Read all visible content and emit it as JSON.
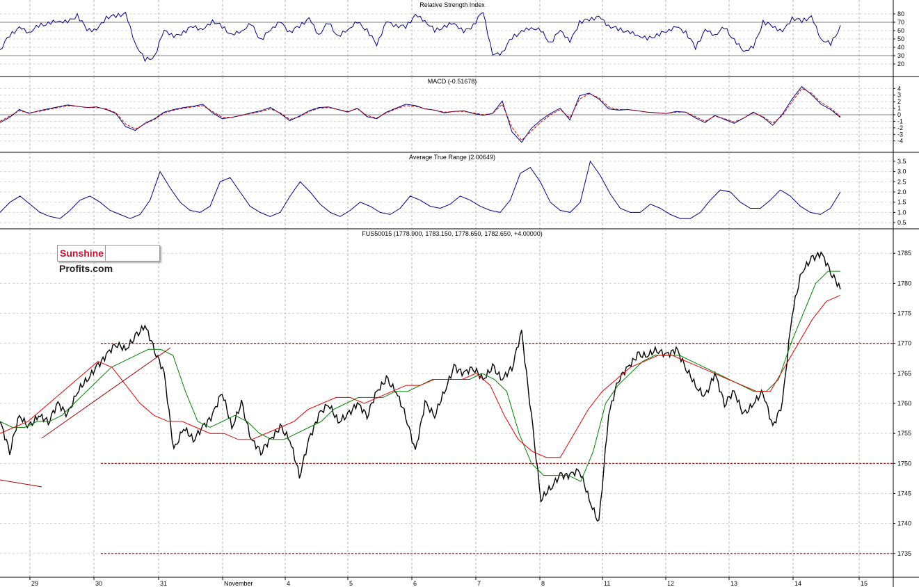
{
  "logo": {
    "part1": "Sunshine",
    "part2": "Profits.com"
  },
  "colors": {
    "price": "#000000",
    "ma_short": "#008000",
    "ma_long": "#e00000",
    "indicator": "#000080",
    "macd_signal": "#c00000",
    "support_line": "#a00000"
  },
  "chart_data": [
    {
      "type": "line",
      "title": "Relative Strength Index",
      "yticks": [
        "80",
        "70",
        "60",
        "50",
        "40",
        "30",
        "20"
      ],
      "ylim": [
        10,
        90
      ],
      "reference_lines": [
        70,
        30
      ],
      "series": [
        {
          "values": [
            37,
            55,
            63,
            58,
            66,
            68,
            72,
            70,
            78,
            62,
            60,
            76,
            78,
            80,
            45,
            25,
            28,
            62,
            52,
            58,
            66,
            60,
            72,
            65,
            54,
            60,
            68,
            48,
            62,
            70,
            58,
            66,
            74,
            55,
            70,
            52,
            62,
            70,
            60,
            44,
            70,
            66,
            65,
            78,
            72,
            60,
            64,
            70,
            58,
            66,
            84,
            30,
            34,
            52,
            58,
            64,
            60,
            44,
            62,
            46,
            70,
            74,
            76,
            66,
            62,
            58,
            55,
            50,
            54,
            60,
            64,
            58,
            40,
            60,
            55,
            64,
            48,
            36,
            40,
            70,
            66,
            58,
            75,
            72,
            76,
            50,
            44,
            64
          ]
        }
      ]
    },
    {
      "type": "line",
      "title": "MACD (-0.51678)",
      "yticks": [
        "4",
        "3",
        "2",
        "1",
        "0",
        "-1",
        "-2",
        "-3",
        "-4"
      ],
      "ylim": [
        -5.2,
        5.2
      ],
      "reference_lines": [
        0
      ],
      "series": [
        {
          "values": [
            -1.2,
            -0.4,
            0.8,
            0.2,
            0.6,
            0.9,
            1.2,
            1.5,
            1.3,
            1.1,
            1.2,
            0.8,
            0.2,
            -1.8,
            -2.4,
            -1.3,
            -0.6,
            0.4,
            0.8,
            1.1,
            1.3,
            1.6,
            0.3,
            -0.6,
            -0.4,
            -0.1,
            0.3,
            0.6,
            1.1,
            0.2,
            -0.9,
            -0.2,
            0.6,
            1.1,
            1.2,
            0.8,
            0.4,
            1.0,
            -0.3,
            -0.6,
            0.4,
            1.0,
            1.6,
            1.4,
            0.9,
            0.7,
            0.3,
            0.5,
            0.6,
            0.2,
            -0.1,
            0.2,
            2.1,
            -2.6,
            -4.2,
            -2.1,
            -0.8,
            0.2,
            1.0,
            -0.8,
            2.9,
            3.3,
            2.4,
            0.9,
            0.7,
            0.8,
            0.6,
            0.4,
            0.3,
            0.2,
            0.5,
            0.4,
            -0.5,
            -1.2,
            -0.1,
            -0.7,
            -1.3,
            -0.5,
            0.4,
            -0.4,
            -1.6,
            0.1,
            2.4,
            4.3,
            3.1,
            1.6,
            0.8,
            -0.4
          ]
        },
        {
          "values": [
            -1.0,
            -0.2,
            0.6,
            0.3,
            0.5,
            0.8,
            1.1,
            1.4,
            1.3,
            1.1,
            1.1,
            0.9,
            0.3,
            -1.4,
            -2.2,
            -1.4,
            -0.7,
            0.3,
            0.7,
            1.0,
            1.2,
            1.4,
            0.5,
            -0.4,
            -0.4,
            -0.1,
            0.2,
            0.5,
            0.9,
            0.3,
            -0.7,
            -0.3,
            0.5,
            1.0,
            1.1,
            0.8,
            0.5,
            0.9,
            -0.1,
            -0.5,
            0.3,
            0.9,
            1.4,
            1.3,
            0.9,
            0.7,
            0.4,
            0.5,
            0.5,
            0.3,
            0.0,
            0.2,
            1.6,
            -1.9,
            -3.9,
            -2.5,
            -1.1,
            0.0,
            0.8,
            -0.5,
            2.4,
            3.2,
            2.6,
            1.2,
            0.8,
            0.8,
            0.6,
            0.4,
            0.3,
            0.2,
            0.4,
            0.4,
            -0.3,
            -1.0,
            -0.2,
            -0.6,
            -1.1,
            -0.5,
            0.3,
            -0.3,
            -1.3,
            -0.1,
            2.0,
            4.0,
            3.3,
            1.9,
            1.0,
            -0.3
          ]
        }
      ]
    },
    {
      "type": "line",
      "title": "Average True Range (2.00649)",
      "yticks": [
        "3.5",
        "3.0",
        "2.5",
        "2.0",
        "1.5",
        "1.0",
        "0.5"
      ],
      "ylim": [
        0.3,
        3.7
      ],
      "series": [
        {
          "values": [
            1.0,
            1.5,
            1.8,
            1.4,
            1.0,
            0.8,
            0.7,
            1.1,
            1.6,
            1.8,
            1.5,
            1.1,
            0.9,
            0.7,
            0.9,
            1.6,
            3.0,
            2.2,
            1.5,
            1.1,
            1.0,
            1.3,
            2.5,
            2.7,
            2.0,
            1.3,
            1.0,
            0.8,
            1.0,
            1.8,
            2.5,
            2.0,
            1.4,
            1.0,
            0.8,
            1.1,
            1.5,
            1.3,
            1.0,
            0.9,
            1.2,
            1.8,
            1.6,
            1.3,
            1.2,
            1.4,
            1.8,
            1.6,
            1.3,
            1.1,
            1.0,
            1.6,
            2.9,
            3.2,
            2.5,
            1.5,
            1.1,
            1.0,
            1.5,
            3.5,
            2.8,
            1.9,
            1.2,
            1.0,
            1.0,
            1.4,
            1.2,
            0.9,
            0.7,
            0.7,
            1.0,
            1.6,
            2.1,
            2.0,
            1.5,
            1.2,
            1.2,
            1.6,
            2.1,
            1.8,
            1.3,
            1.0,
            0.9,
            1.2,
            2.0
          ]
        }
      ]
    },
    {
      "type": "line",
      "title": "FUS50015 (1778.900, 1783.150, 1778.650, 1782.650, +4.00000)",
      "yticks": [
        "1785",
        "1780",
        "1775",
        "1770",
        "1765",
        "1760",
        "1755",
        "1750",
        "1745",
        "1740",
        "1735"
      ],
      "ylim": [
        1731.5,
        1788.5
      ],
      "xticks": [
        "29",
        "30",
        "31",
        "November",
        "4",
        "5",
        "6",
        "7",
        "8",
        "11",
        "12",
        "13",
        "14",
        "15"
      ],
      "reference_lines": [
        1770,
        1750,
        1735
      ],
      "series": [
        {
          "values": [
            1757,
            1752,
            1758,
            1756,
            1758,
            1757,
            1760,
            1758,
            1762,
            1764,
            1766,
            1768,
            1770,
            1769,
            1771,
            1773,
            1769,
            1765,
            1752,
            1756,
            1754,
            1756,
            1758,
            1762,
            1756,
            1760,
            1754,
            1752,
            1754,
            1756,
            1754,
            1748,
            1754,
            1758,
            1760,
            1757,
            1758,
            1760,
            1758,
            1762,
            1764,
            1762,
            1758,
            1752,
            1760,
            1758,
            1762,
            1766,
            1765,
            1766,
            1764,
            1766,
            1764,
            1766,
            1772,
            1758,
            1744,
            1746,
            1748,
            1748,
            1749,
            1744,
            1740,
            1758,
            1764,
            1766,
            1768,
            1768,
            1769,
            1768,
            1769,
            1766,
            1763,
            1761,
            1765,
            1760,
            1762,
            1758,
            1760,
            1762,
            1756,
            1760,
            1775,
            1782,
            1784,
            1785,
            1782,
            1779
          ]
        },
        {
          "values": [
            1757,
            1756,
            1756,
            1757,
            1757,
            1758,
            1760,
            1762,
            1764,
            1766,
            1767,
            1768,
            1769,
            1769,
            1768,
            1762,
            1757,
            1756,
            1757,
            1758,
            1757,
            1755,
            1754,
            1754,
            1755,
            1756,
            1757,
            1759,
            1760,
            1761,
            1761,
            1761,
            1762,
            1762,
            1763,
            1764,
            1764,
            1764,
            1764,
            1765,
            1764,
            1762,
            1755,
            1750,
            1748,
            1748,
            1748,
            1747,
            1752,
            1760,
            1763,
            1765,
            1767,
            1768,
            1768,
            1768,
            1767,
            1766,
            1765,
            1764,
            1763,
            1762,
            1762,
            1764,
            1770,
            1775,
            1780,
            1782,
            1782
          ]
        },
        {
          "values": [
            1755,
            1756,
            1757,
            1759,
            1761,
            1763,
            1765,
            1767,
            1766,
            1763,
            1760,
            1758,
            1757,
            1757,
            1756,
            1755,
            1755,
            1754,
            1754,
            1755,
            1756,
            1757,
            1759,
            1760,
            1761,
            1761,
            1760,
            1761,
            1762,
            1763,
            1763,
            1764,
            1764,
            1764,
            1765,
            1763,
            1758,
            1754,
            1752,
            1751,
            1751,
            1755,
            1759,
            1762,
            1764,
            1766,
            1767,
            1768,
            1768,
            1767,
            1766,
            1765,
            1764,
            1763,
            1762,
            1762,
            1766,
            1770,
            1774,
            1777,
            1778
          ]
        }
      ]
    }
  ]
}
